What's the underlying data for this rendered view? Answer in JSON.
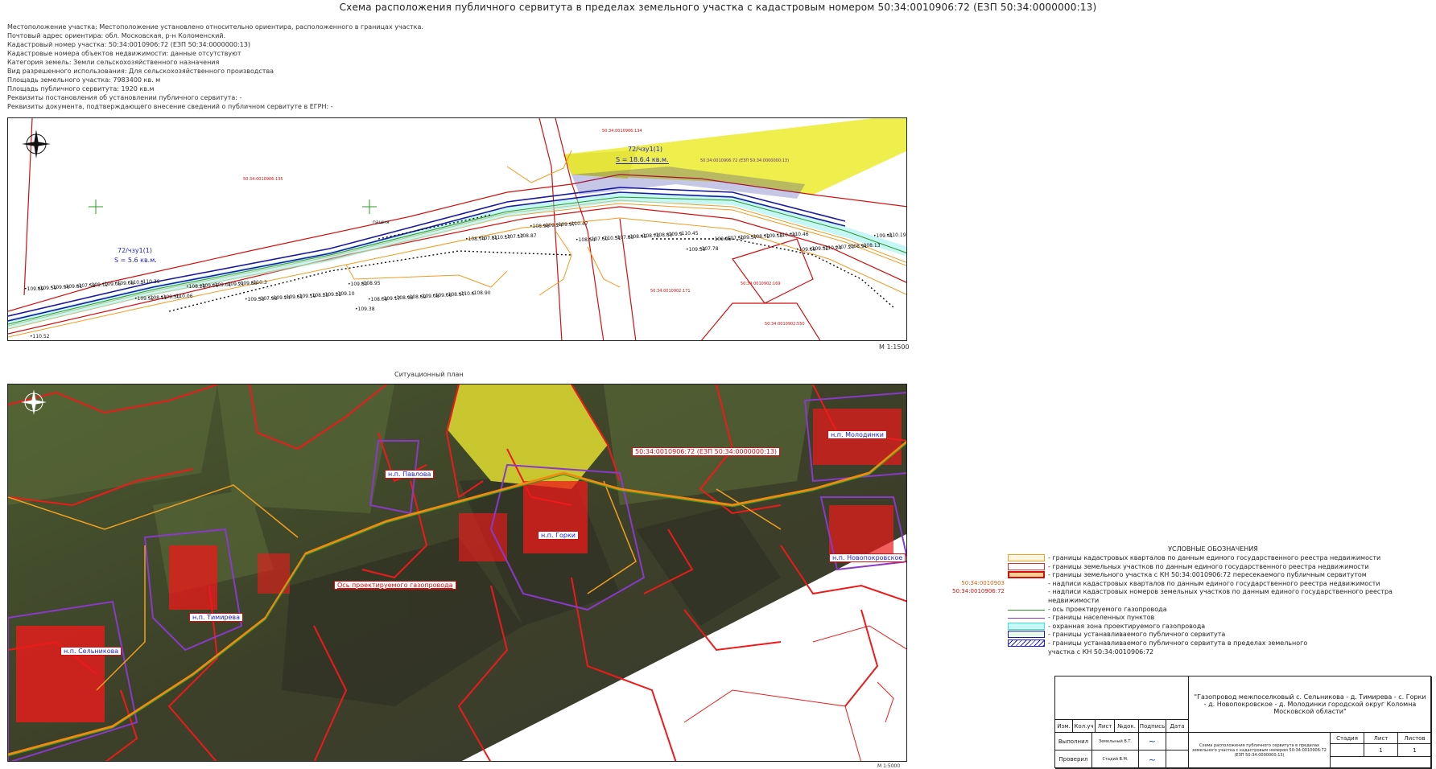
{
  "title": "Схема расположения публичного сервитута в пределах земельного участка с кадастровым номером 50:34:0010906:72 (ЕЗП 50:34:0000000:13)",
  "info_lines": [
    "Местоположение участка: Местоположение установлено относительно ориентира, расположенного в границах участка.",
    "Почтовый адрес ориентира: обл. Московская, р-н Коломенский.",
    "Кадастровый номер участка: 50:34:0010906:72 (ЕЗП 50:34:0000000:13)",
    "Кадастровые номера объектов недвижимости: данные отсутствуют",
    "Категория земель: Земли сельскохозяйственного назначения",
    "Вид разрешенного использования: Для сельскохозяйственного производства",
    "Площадь земельного участка: 7983400 кв. м",
    "Площадь публичного сервитута: 1920 кв.м",
    "Реквизиты постановления об установлении публичного сервитута: -",
    "Реквизиты документа, подтверждающего внесение сведений о публичном сервитуте в ЕГРН: -"
  ],
  "top_map": {
    "scale": "М 1:1500",
    "servitude_1": {
      "id": "72/чзу1(1)",
      "area": "S = 18.6.4 кв.м."
    },
    "servitude_2": {
      "id": "72/чзу1(1)",
      "area": "S = 5.6 кв.м."
    },
    "parcel_labels": [
      "50:34:0010906:135",
      "50:34:0010906:72 (ЕЗП 50:34:0000000:13)",
      "50:34:0010902:171",
      "50:34:0010902:169",
      "50:34:0010902:550",
      "50:34:0010906:134"
    ],
    "elevations": [
      "109.89",
      "109.52",
      "109.33",
      "109.38",
      "108.74",
      "108.54",
      "109.39",
      "109.69",
      "109.59",
      "108.11",
      "107.98",
      "108.09",
      "107.81",
      "107.60",
      "107.78",
      "109.32",
      "109.96",
      "109.30",
      "109.24",
      "109.17",
      "110.17",
      "110.31",
      "109.95",
      "110.24",
      "109.81",
      "110.06",
      "109.61",
      "108.98",
      "107.17",
      "107.83",
      "107.50",
      "107.20",
      "107.58",
      "108.29",
      "109.19",
      "108.69",
      "108.87",
      "108.45",
      "109.37",
      "108.91",
      "109.12",
      "109.05",
      "108.25",
      "109.08",
      "108.96",
      "108.70",
      "108.72",
      "108.13",
      "109.05",
      "109.01",
      "109.22",
      "109.06",
      "109.24",
      "108.83",
      "109.13",
      "109.41",
      "109.08",
      "109.21",
      "109.10",
      "108.97",
      "109.97",
      "109.9",
      "110.04",
      "110.19",
      "110.2",
      "109.83",
      "109.80",
      "110.6",
      "110.47",
      "110.45",
      "110.46",
      "110.52",
      "110.39",
      "110.3",
      "108.95",
      "108.90"
    ],
    "misc": [
      "пашня",
      "п",
      "п",
      "п"
    ]
  },
  "situation_plan": {
    "title": "Ситуационный план",
    "scale": "М 1:5000",
    "settlements": [
      "н.п. Павлова",
      "н.п. Горки",
      "н.п. Тимирева",
      "н.п. Сельникова",
      "н.п. Молодинки",
      "н.п. Новопокровское"
    ],
    "parcel_callout": "50:34:0010906:72 (ЕЗП 50:34:0000000:13)",
    "axis_callout": "Ось проектируемого газопровода"
  },
  "legend": {
    "title": "УСЛОВНЫЕ ОБОЗНАЧЕНИЯ",
    "items": [
      {
        "text": "- границы кадастровых кварталов по данным единого государственного реестра недвижимости",
        "color": "#f5a020",
        "kind": "double"
      },
      {
        "text": "- границы земельных участков по данным единого государственного реестра недвижимости",
        "color": "#e03030",
        "kind": "box"
      },
      {
        "text": "- границы земельного участка с КН 50:34:0010906:72 пересекаемого публичным сервитутом",
        "color": "#d01010",
        "kind": "thick"
      },
      {
        "text": "- надписи кадастровых кварталов по данным единого государственного реестра недвижимости",
        "color": "#e06010",
        "kind": "text",
        "prefix": "50:34:0010903"
      },
      {
        "text": "- надписи кадастровых номеров земельных участков по данным единого государственного реестра",
        "color": "#d01010",
        "kind": "text",
        "prefix": "50:34:0010906:72"
      },
      {
        "text": "недвижимости",
        "color": "",
        "kind": "none"
      },
      {
        "text": "- ось проектируемого газопровода",
        "color": "#2a9a2a",
        "kind": "line"
      },
      {
        "text": "- границы населенных пунктов",
        "color": "#8a3ac8",
        "kind": "line"
      },
      {
        "text": "- охранная зона проектируемого газопровода",
        "color": "#40e0e0",
        "kind": "zone"
      },
      {
        "text": "- границы устанавливаемого публичного сервитута",
        "color": "#1a1aa0",
        "kind": "zone2"
      },
      {
        "text": "- границы устанавливаемого публичного сервитута в пределах земельного",
        "color": "#2222cc",
        "kind": "hatch"
      },
      {
        "text": "участка с КН 50:34:0010906:72",
        "color": "",
        "kind": "none"
      }
    ]
  },
  "stamp": {
    "project": "\"Газопровод межпоселковый с. Сельникова - д. Тимирева - с. Горки - д. Новопокровское - д. Молодинки городской округ Коломна Московской области\"",
    "doc_title": "Схема расположения публичного сервитута в пределах земельного участка с кадастровым номером 50:34:0010906:72 (ЕЗП 50:34:0000000:13)",
    "headers": [
      "Изм.",
      "Кол.уч",
      "Лист",
      "№док.",
      "Подпись",
      "Дата"
    ],
    "stage_headers": [
      "Стадия",
      "Лист",
      "Листов"
    ],
    "sheet": "1",
    "sheets": "1",
    "rows": [
      {
        "role": "Выполнил",
        "name": "Земельный В.Т."
      },
      {
        "role": "Проверил",
        "name": "Стадий В.М."
      }
    ]
  }
}
